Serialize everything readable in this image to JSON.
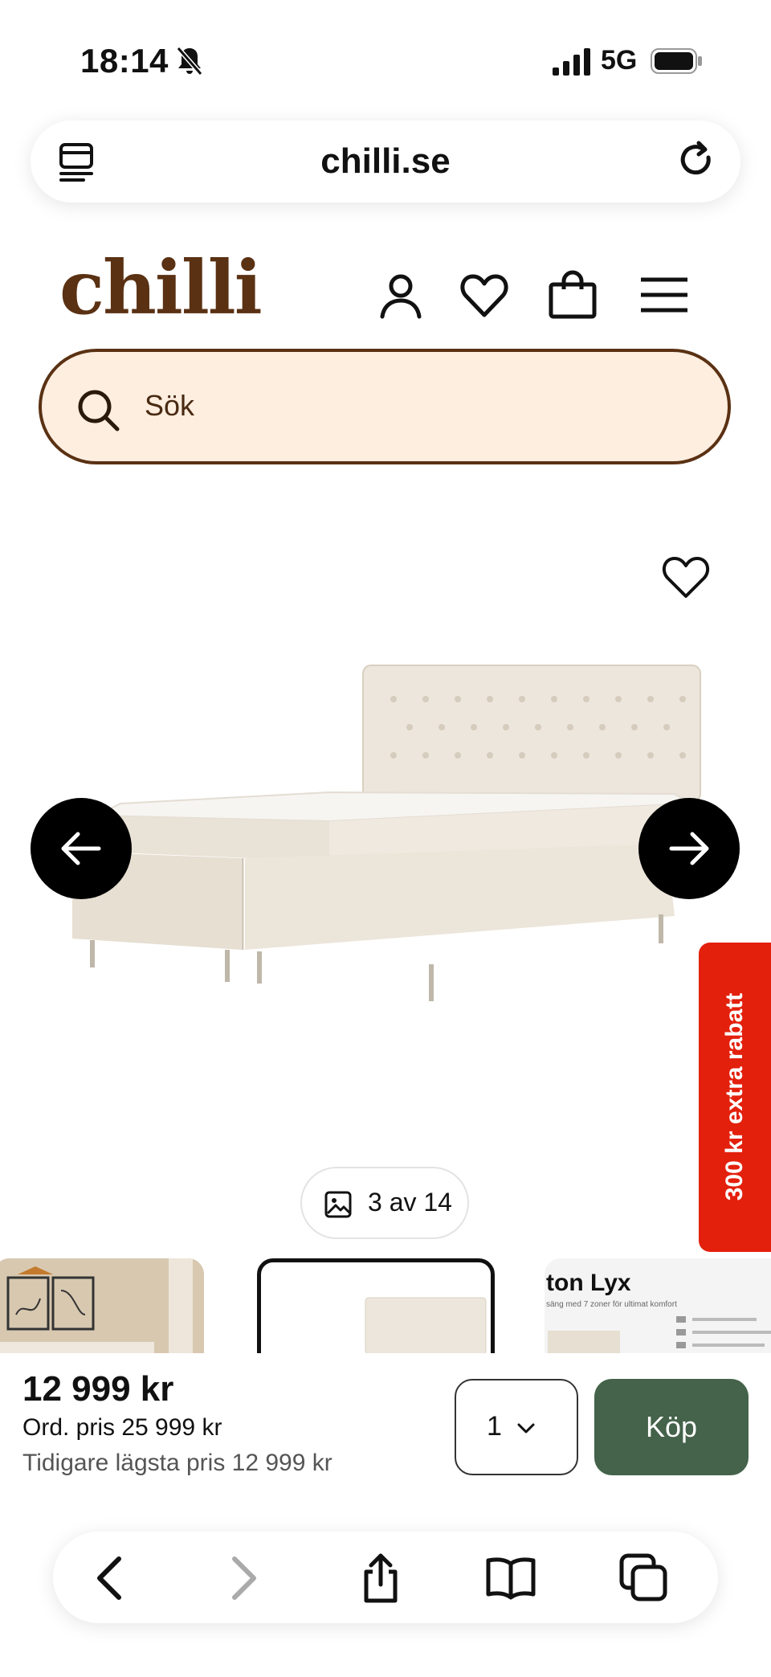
{
  "status_bar": {
    "time": "18:14",
    "network": "5G",
    "icons": [
      "bell-slash-icon",
      "signal-icon",
      "battery-icon"
    ]
  },
  "browser": {
    "url": "chilli.se",
    "icons": [
      "tabs-icon",
      "reload-icon"
    ]
  },
  "site": {
    "logo": "chilli",
    "header_icons": [
      "account-icon",
      "heart-icon",
      "bag-icon",
      "menu-icon"
    ],
    "search_placeholder": "Sök",
    "brand_color": "#5a3113",
    "search_bg": "#fdeee0"
  },
  "gallery": {
    "counter": "3 av 14",
    "promo": "300 kr extra rabatt",
    "promo_color": "#e3200c",
    "thumb3_title": "ton Lyx",
    "thumb3_subtitle": "säng med 7 zoner för ultimat komfort"
  },
  "buy_bar": {
    "price": "12 999 kr",
    "ord_price": "Ord. pris 25 999 kr",
    "lowest_price": "Tidigare lägsta pris 12 999 kr",
    "quantity": "1",
    "buy_label": "Köp",
    "buy_color": "#44634a"
  },
  "toolbar": {
    "icons": [
      "back-icon",
      "forward-icon",
      "share-icon",
      "bookmarks-icon",
      "tabs-icon"
    ]
  }
}
